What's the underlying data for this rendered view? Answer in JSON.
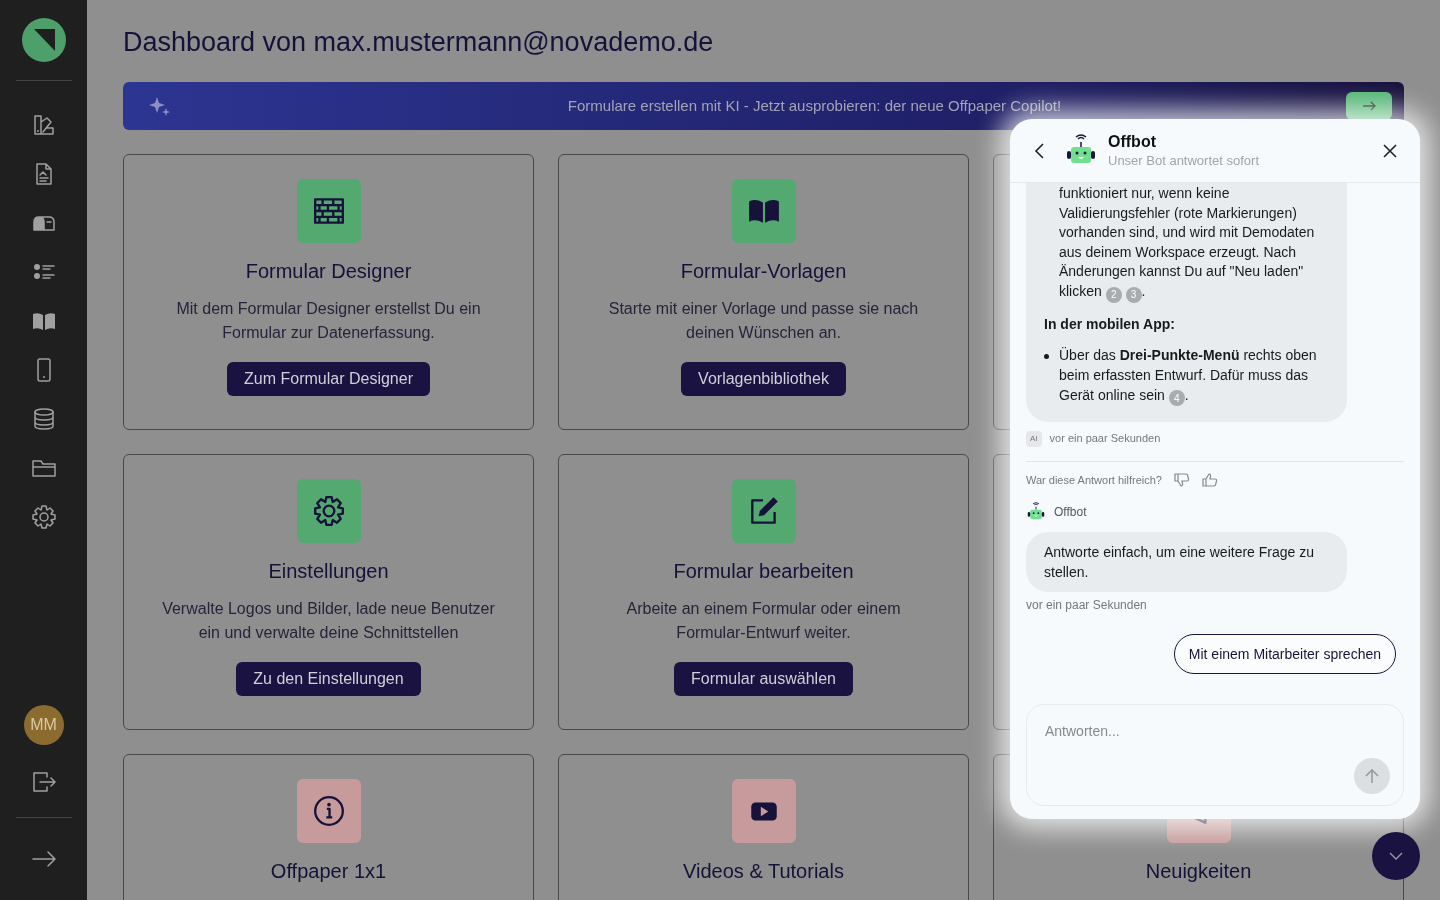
{
  "sidebar": {
    "avatar": "MM"
  },
  "page": {
    "title": "Dashboard von max.mustermann@novademo.de"
  },
  "banner": {
    "text": "Formulare erstellen mit KI - Jetzt ausprobieren: der neue Offpaper Copilot!"
  },
  "cards": [
    {
      "kind": "tile",
      "title": "Formular Designer",
      "description": "Mit dem Formular Designer erstellst Du ein Formular zur Datenerfassung.",
      "button": "Zum Formular Designer",
      "color": "#53a970"
    },
    {
      "kind": "tile",
      "title": "Formular-Vorlagen",
      "description": "Starte mit einer Vorlage und passe sie nach deinen Wünschen an.",
      "button": "Vorlagenbibliothek",
      "color": "#53a970"
    },
    {
      "kind": "covered"
    },
    {
      "kind": "tile",
      "title": "Einstellungen",
      "description": "Verwalte Logos und Bilder, lade neue Benutzer ein und verwalte deine Schnittstellen",
      "button": "Zu den Einstellungen",
      "color": "#53a970"
    },
    {
      "kind": "tile",
      "title": "Formular bearbeiten",
      "description": "Arbeite an einem Formular oder einem Formular-Entwurf weiter.",
      "button": "Formular auswählen",
      "color": "#53a970"
    },
    {
      "kind": "covered"
    },
    {
      "kind": "tile",
      "title": "Offpaper 1x1",
      "color": "#c79b9b"
    },
    {
      "kind": "tile",
      "title": "Videos & Tutorials",
      "color": "#c79b9b"
    },
    {
      "kind": "tile",
      "title": "Neuigkeiten",
      "color": "#c79b9b"
    }
  ],
  "chat": {
    "title": "Offbot",
    "subtitle": "Unser Bot antwortet sofort",
    "answer": {
      "blocks": [
        {
          "kind": "list",
          "items": [
            {
              "continued": true,
              "text": "funktioniert nur, wenn keine Validierungsfehler (rote Markierungen) vorhanden sind, und wird mit Demodaten aus deinem Workspace erzeugt. Nach Änderungen kannst Du auf \"Neu laden\" klicken",
              "citations": [
                "2",
                "3"
              ],
              "end": "."
            }
          ]
        },
        {
          "kind": "heading",
          "text": "In der mobilen App:"
        },
        {
          "kind": "list",
          "items": [
            {
              "continued": false,
              "text": "Über das **Drei-Punkte-Menü** rechts oben beim erfassten Entwurf. Dafür muss das Gerät online sein",
              "citations": [
                "4"
              ],
              "end": "."
            }
          ]
        }
      ],
      "badge": "AI",
      "time": "vor ein paar Sekunden"
    },
    "feedback": "War diese Antwort hilfreich?",
    "followup": {
      "sender": "Offbot",
      "text": "Antworte einfach, um eine weitere Frage zu stellen.",
      "time": "vor ein paar Sekunden"
    },
    "action_button": "Mit einem Mitarbeiter sprechen",
    "input": {
      "placeholder": "Antworten..."
    }
  }
}
